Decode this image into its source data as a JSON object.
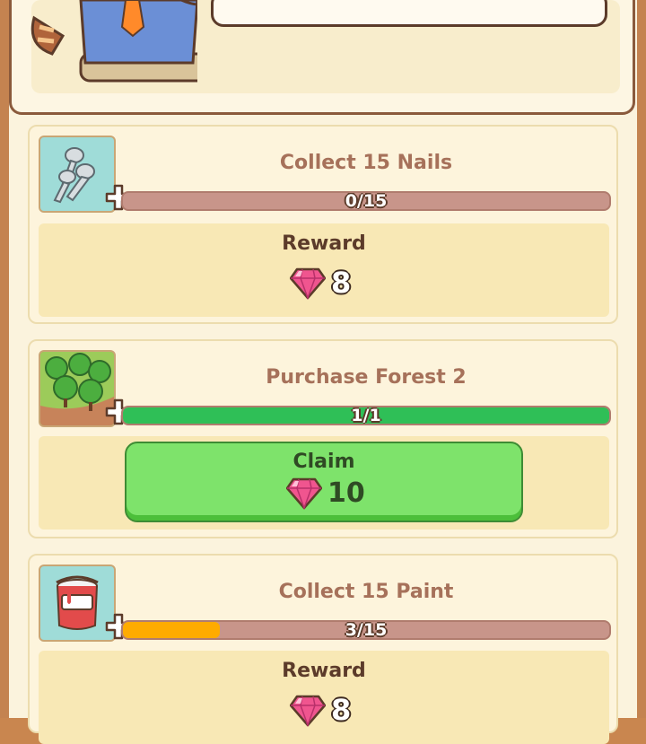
{
  "colors": {
    "gem": "#f0558f",
    "progress_track": "#c8958a",
    "progress_complete": "#2fbf57",
    "progress_partial": "#ffab00",
    "claim_button": "#7ee36b"
  },
  "quests": [
    {
      "icon": "nails-icon",
      "title": "Collect 15 Nails",
      "progress_text": "0/15",
      "progress_fraction": 0.0,
      "reward_label": "Reward",
      "reward_amount": "8",
      "state": "in-progress"
    },
    {
      "icon": "forest-icon",
      "title": "Purchase Forest 2",
      "progress_text": "1/1",
      "progress_fraction": 1.0,
      "claim_label": "Claim",
      "reward_amount": "10",
      "state": "claimable"
    },
    {
      "icon": "paint-bucket-icon",
      "title": "Collect 15 Paint",
      "progress_text": "3/15",
      "progress_fraction": 0.2,
      "reward_label": "Reward",
      "reward_amount": "8",
      "state": "in-progress"
    }
  ]
}
